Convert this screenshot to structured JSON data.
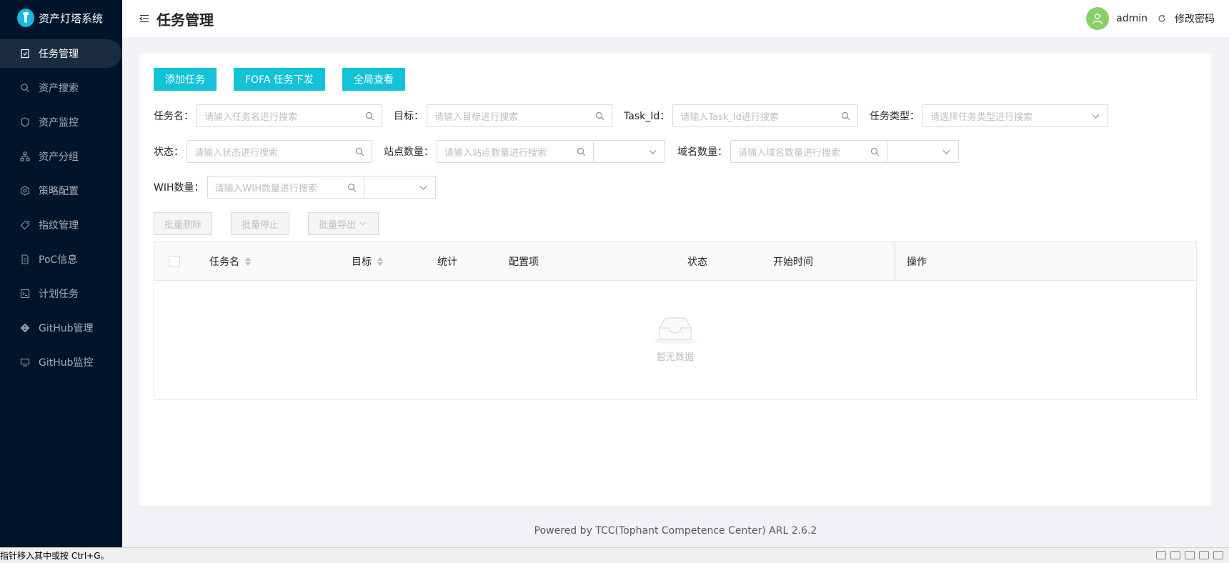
{
  "app": {
    "name": "资产灯塔系统"
  },
  "sidebar": {
    "items": [
      {
        "label": "任务管理",
        "icon": "task-icon",
        "active": true
      },
      {
        "label": "资产搜索",
        "icon": "search-icon"
      },
      {
        "label": "资产监控",
        "icon": "shield-icon"
      },
      {
        "label": "资产分组",
        "icon": "cluster-icon"
      },
      {
        "label": "策略配置",
        "icon": "settings-icon"
      },
      {
        "label": "指纹管理",
        "icon": "tag-icon"
      },
      {
        "label": "PoC信息",
        "icon": "file-icon"
      },
      {
        "label": "计划任务",
        "icon": "code-icon"
      },
      {
        "label": "GitHub管理",
        "icon": "git-icon"
      },
      {
        "label": "GitHub监控",
        "icon": "monitor-icon"
      }
    ]
  },
  "header": {
    "title": "任务管理",
    "username": "admin",
    "change_password": "修改密码"
  },
  "toolbar": {
    "add_task": "添加任务",
    "fofa_task": "FOFA 任务下发",
    "global_view": "全局查看"
  },
  "filters": {
    "task_name": {
      "label": "任务名：",
      "placeholder": "请输入任务名进行搜索"
    },
    "target": {
      "label": "目标：",
      "placeholder": "请输入目标进行搜索"
    },
    "task_id": {
      "label": "Task_Id：",
      "placeholder": "请输入Task_Id进行搜索"
    },
    "task_type": {
      "label": "任务类型：",
      "placeholder": "请选择任务类型进行搜索"
    },
    "status": {
      "label": "状态：",
      "placeholder": "请输入状态进行搜索"
    },
    "site_count": {
      "label": "站点数量：",
      "placeholder": "请输入站点数量进行搜索"
    },
    "domain_count": {
      "label": "域名数量：",
      "placeholder": "请输入域名数量进行搜索"
    },
    "wih_count": {
      "label": "WIH数量：",
      "placeholder": "请输入WIH数量进行搜索"
    }
  },
  "batch": {
    "delete": "批量删除",
    "stop": "批量停止",
    "export": "批量导出"
  },
  "table": {
    "columns": [
      "任务名",
      "目标",
      "统计",
      "配置项",
      "状态",
      "开始时间",
      "操作"
    ],
    "empty_text": "暂无数据"
  },
  "footer": {
    "text": "Powered by TCC(Tophant Competence Center) ARL 2.6.2"
  },
  "statusbar": {
    "text": "指针移入其中或按 Ctrl+G。"
  },
  "colors": {
    "sidebar_bg": "#001529",
    "primary": "#13c2d7",
    "avatar": "#87d068"
  }
}
